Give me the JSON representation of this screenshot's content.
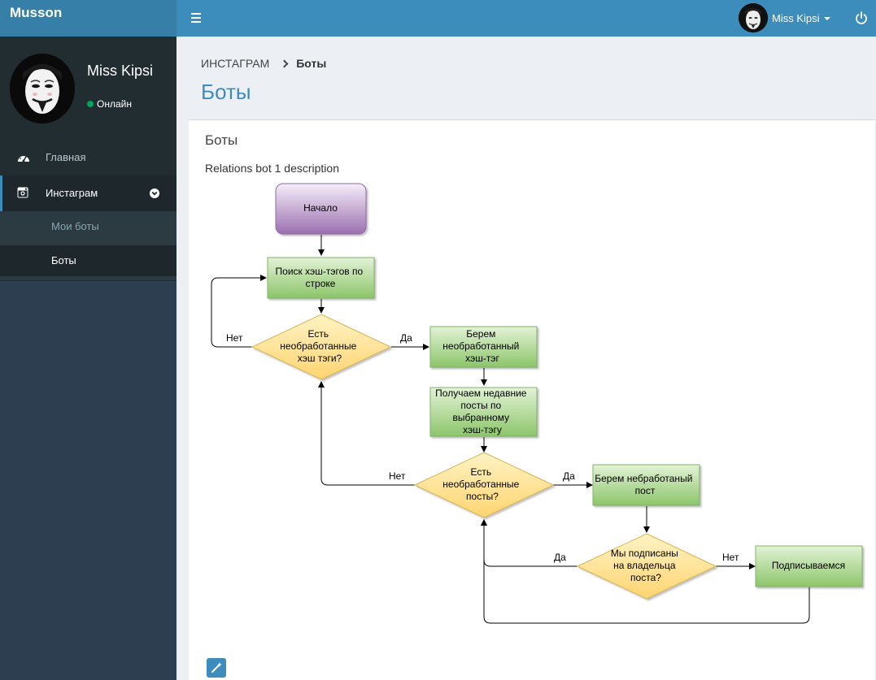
{
  "app": {
    "brand": "Musson"
  },
  "topbar": {
    "user_name": "Miss Kipsi",
    "menu_icon": "hamburger-icon",
    "power_icon": "power-icon"
  },
  "sidebar": {
    "user": {
      "name": "Miss Kipsi",
      "status": "Онлайн"
    },
    "items": [
      {
        "label": "Главная",
        "icon": "dashboard-icon"
      },
      {
        "label": "Инстаграм",
        "icon": "instagram-icon"
      }
    ],
    "submenu": [
      {
        "label": "Мои боты"
      },
      {
        "label": "Боты"
      }
    ]
  },
  "breadcrumb": {
    "parent": "ИНСТАГРАМ",
    "current": "Боты"
  },
  "page": {
    "title": "Боты"
  },
  "box": {
    "title": "Боты",
    "description": "Relations bot 1 description",
    "edit_icon": "magic-wand-icon"
  },
  "flowchart": {
    "nodes": {
      "start": "Начало",
      "search": [
        "Поиск хэш-тэгов по",
        "строке"
      ],
      "has_tags": [
        "Есть",
        "необработанные",
        "хэш тэги?"
      ],
      "take_tag": [
        "Берем",
        "необработанный",
        "хэш-тэг"
      ],
      "get_posts": [
        "Получаем недавние",
        "посты по",
        "выбранному",
        "хэш-тэгу"
      ],
      "has_posts": [
        "Есть",
        "необработанные",
        "посты?"
      ],
      "take_post": [
        "Берем небработаный",
        "пост"
      ],
      "subscribed": [
        "Мы подписаны",
        "на владельца",
        "поста?"
      ],
      "subscribe": "Подписываемся"
    },
    "edges": {
      "no": "Нет",
      "yes": "Да"
    }
  },
  "colors": {
    "topbar": "#3c8dbc",
    "sidebar": "#222d32",
    "accent": "#3c8dbc",
    "online": "#00a65a"
  }
}
